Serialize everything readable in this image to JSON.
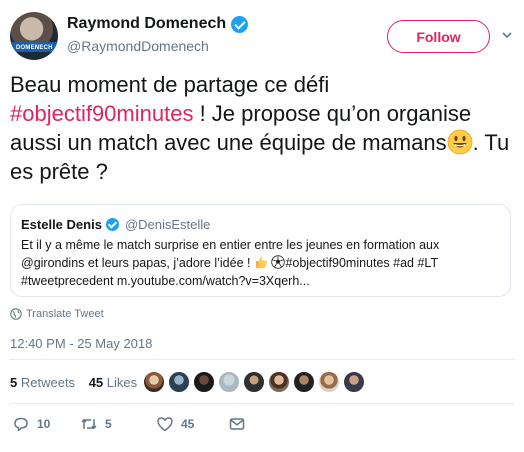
{
  "header": {
    "display_name": "Raymond Domenech",
    "handle": "@RaymondDomenech",
    "avatar_text": "DOMENECH",
    "follow_label": "Follow"
  },
  "tweet": {
    "text_part1": "Beau moment de partage ce défi ",
    "hashtag": "#objectif90minutes",
    "text_part2": " ! Je propose qu’on organise aussi un match avec une équipe de mamans",
    "text_part3": ". Tu es prête ?"
  },
  "quote": {
    "name": "Estelle Denis",
    "handle": "@DenisEstelle",
    "text_part1": "Et il y a même le match surprise en entier entre les jeunes en formation aux @girondins et leurs papas, j’adore l’idée ! ",
    "text_part2": "#objectif90minutes #ad #LT #tweetprecedent m.youtube.com/watch?v=3Xqerh..."
  },
  "translate_label": "Translate Tweet",
  "timestamp": "12:40 PM - 25 May 2018",
  "stats": {
    "retweets_count": "5",
    "retweets_label": "Retweets",
    "likes_count": "45",
    "likes_label": "Likes"
  },
  "actions": {
    "reply_count": "10",
    "retweet_count": "5",
    "like_count": "45"
  },
  "colors": {
    "accent": "#e0245e",
    "verified": "#1da1f2",
    "muted": "#657786"
  }
}
